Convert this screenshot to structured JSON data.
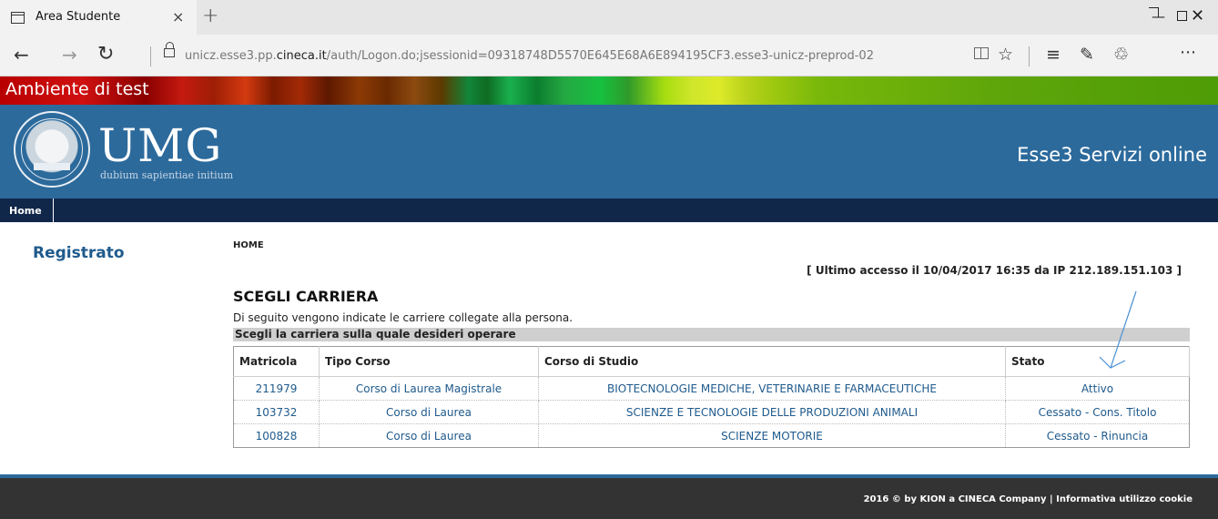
{
  "browser": {
    "tab_title": "Area Studente",
    "tab_close": "×",
    "new_tab": "+",
    "url_prefix": "unicz.esse3.pp.",
    "url_domain": "cineca.it",
    "url_rest": "/auth/Logon.do;jsessionid=09318748D5570E645E68A6E894195CF3.esse3-unicz-preprod-02",
    "icons": {
      "back": "←",
      "forward": "→",
      "refresh": "↻",
      "star": "☆",
      "hub": "≡",
      "note": "✎",
      "share": "♲",
      "more": "⋯",
      "minimize": "—",
      "close": "✕"
    }
  },
  "banner": {
    "label": "Ambiente di test"
  },
  "header": {
    "logo_text": "UMG",
    "motto": "dubium sapientiae initium",
    "service": "Esse3 Servizi online"
  },
  "nav": {
    "home": "Home"
  },
  "sidebar": {
    "title": "Registrato"
  },
  "main": {
    "breadcrumb": "HOME",
    "last_access": "[ Ultimo accesso il 10/04/2017 16:35 da IP 212.189.151.103 ]",
    "title": "SCEGLI CARRIERA",
    "description": "Di seguito vengono indicate le carriere collegate alla persona.",
    "table_caption": "Scegli la carriera sulla quale desideri operare",
    "columns": [
      "Matricola",
      "Tipo Corso",
      "Corso di Studio",
      "Stato"
    ],
    "rows": [
      {
        "matricola": "211979",
        "tipo": "Corso di Laurea Magistrale",
        "corso": "BIOTECNOLOGIE MEDICHE, VETERINARIE E FARMACEUTICHE",
        "stato": "Attivo"
      },
      {
        "matricola": "103732",
        "tipo": "Corso di Laurea",
        "corso": "SCIENZE E TECNOLOGIE DELLE PRODUZIONI ANIMALI",
        "stato": "Cessato - Cons. Titolo"
      },
      {
        "matricola": "100828",
        "tipo": "Corso di Laurea",
        "corso": "SCIENZE MOTORIE",
        "stato": "Cessato - Rinuncia"
      }
    ]
  },
  "footer": {
    "text": "2016 © by KION a CINECA Company | Informativa utilizzo cookie"
  },
  "colors": {
    "header_blue": "#2c6a9c",
    "nav_dark": "#10274a",
    "link_blue": "#1f5a8c",
    "footer_dark": "#333333",
    "annotation": "#4a90d9"
  }
}
